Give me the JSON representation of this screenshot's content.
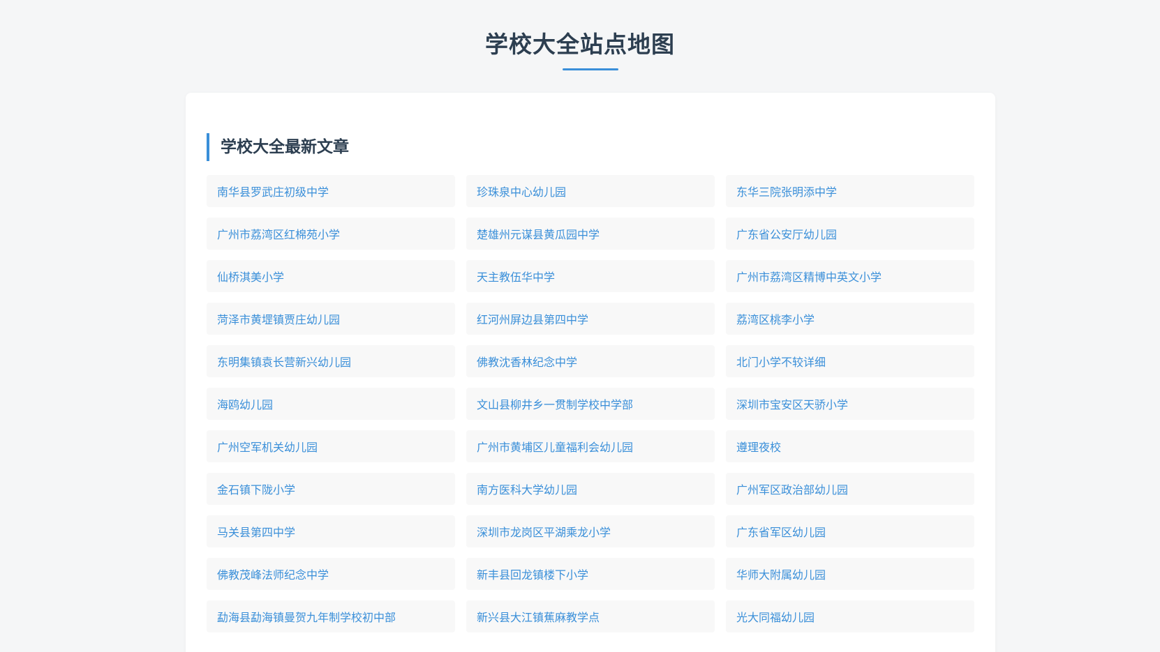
{
  "page": {
    "title": "学校大全站点地图",
    "accent_color": "#3a8fd9",
    "text_color": "#2c3e50",
    "background_color": "#f5f6f7"
  },
  "section": {
    "heading": "学校大全最新文章"
  },
  "articles": [
    "南华县罗武庄初级中学",
    "珍珠泉中心幼儿园",
    "东华三院张明添中学",
    "广州市荔湾区红棉苑小学",
    "楚雄州元谋县黄瓜园中学",
    "广东省公安厅幼儿园",
    "仙桥淇美小学",
    "天主教伍华中学",
    "广州市荔湾区精博中英文小学",
    "菏泽市黄堽镇贾庄幼儿园",
    "红河州屏边县第四中学",
    "荔湾区桃李小学",
    "东明集镇袁长营新兴幼儿园",
    "佛教沈香林纪念中学",
    "北门小学不较详细",
    "海鸥幼儿园",
    "文山县柳井乡一贯制学校中学部",
    "深圳市宝安区天骄小学",
    "广州空军机关幼儿园",
    "广州市黄埔区儿童福利会幼儿园",
    "遵理夜校",
    "金石镇下陇小学",
    "南方医科大学幼儿园",
    "广州军区政治部幼儿园",
    "马关县第四中学",
    "深圳市龙岗区平湖乘龙小学",
    "广东省军区幼儿园",
    "佛教茂峰法师纪念中学",
    "新丰县回龙镇楼下小学",
    "华师大附属幼儿园",
    "勐海县勐海镇曼贺九年制学校初中部",
    "新兴县大江镇蕉麻教学点",
    "光大同福幼儿园"
  ]
}
